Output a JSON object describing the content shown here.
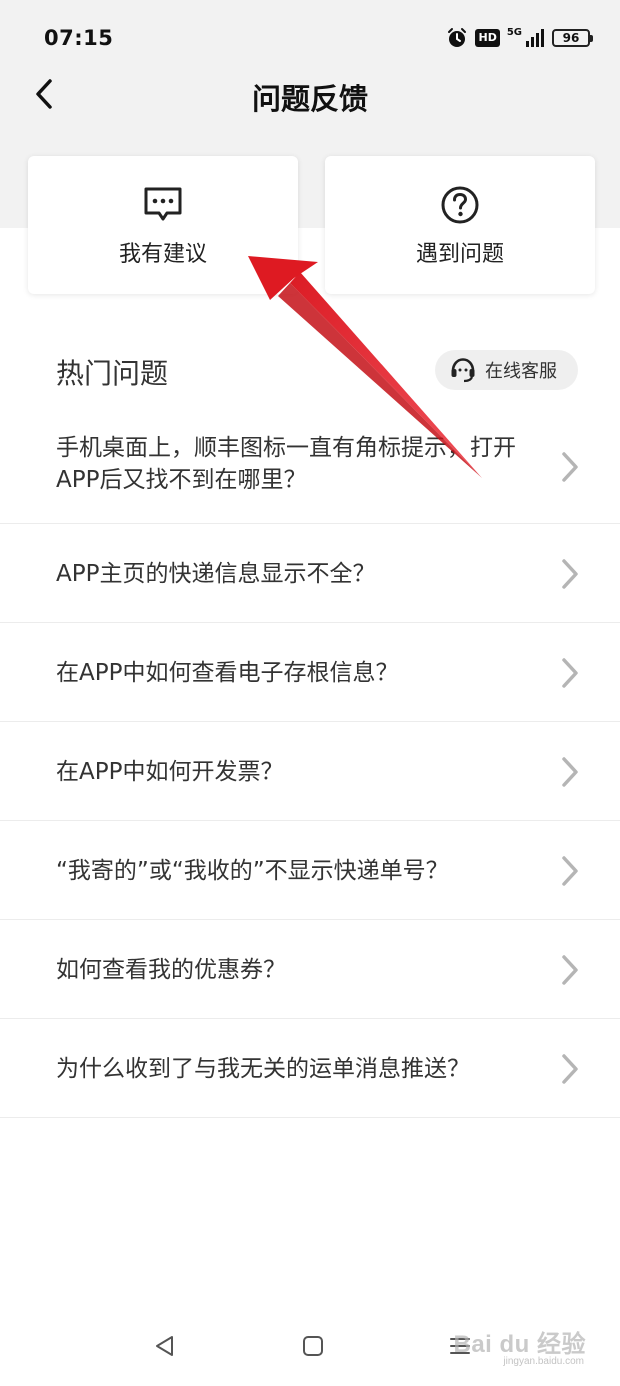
{
  "status_bar": {
    "time": "07:15",
    "hd": "HD",
    "network": "5G",
    "battery": "96"
  },
  "header": {
    "title": "问题反馈"
  },
  "cards": {
    "suggest_label": "我有建议",
    "problem_label": "遇到问题"
  },
  "hot": {
    "title": "热门问题",
    "service_label": "在线客服"
  },
  "faq": [
    "手机桌面上，顺丰图标一直有角标提示，打开APP后又找不到在哪里？",
    "APP主页的快递信息显示不全？",
    "在APP中如何查看电子存根信息？",
    "在APP中如何开发票？",
    "“我寄的”或“我收的”不显示快递单号？",
    "如何查看我的优惠券？",
    "为什么收到了与我无关的运单消息推送？"
  ],
  "watermark": {
    "text": "Bai du 经验",
    "url": "jingyan.baidu.com"
  },
  "icons": {
    "back": "back-arrow-icon",
    "suggest": "message-dots-icon",
    "problem": "question-circle-icon",
    "service": "headset-icon",
    "chevron": "chevron-right-icon"
  },
  "colors": {
    "annotation_arrow": "#e8232a",
    "header_bg": "#f2f2f2"
  }
}
